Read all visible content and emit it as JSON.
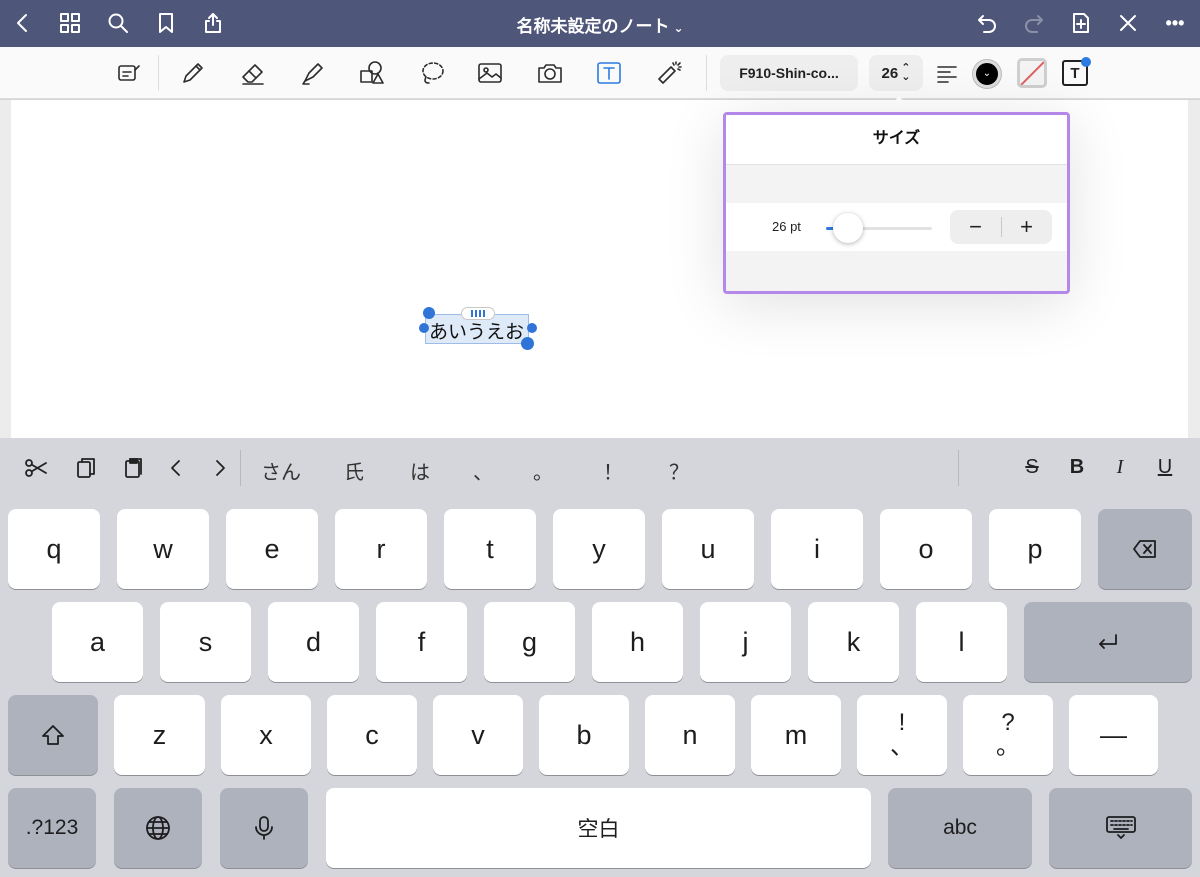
{
  "titlebar": {
    "title": "名称未設定のノート",
    "chevron": "⌄",
    "more": "•••"
  },
  "toolbar": {
    "font_name": "F910-Shin-co...",
    "font_size": "26",
    "size_arrows_up": "⌃",
    "size_arrows_down": "⌄",
    "text_box_label": "T",
    "color_selected": "#000000",
    "accent_color": "#2b7be0"
  },
  "canvas": {
    "text_content": "あいうえお"
  },
  "size_popover": {
    "title": "サイズ",
    "value_label": "26 pt",
    "slider_fraction": 0.08,
    "minus": "−",
    "plus": "+",
    "border_color": "#b488e8"
  },
  "shortcut_bar": {
    "suggestions": [
      "さん",
      "氏",
      "は",
      "、",
      "。",
      "！",
      "？"
    ],
    "format": {
      "strike": "S",
      "bold": "B",
      "italic": "I",
      "underline": "U"
    }
  },
  "keyboard": {
    "row1": [
      "q",
      "w",
      "e",
      "r",
      "t",
      "y",
      "u",
      "i",
      "o",
      "p"
    ],
    "row2": [
      "a",
      "s",
      "d",
      "f",
      "g",
      "h",
      "j",
      "k",
      "l"
    ],
    "row3": [
      "z",
      "x",
      "c",
      "v",
      "b",
      "n",
      "m"
    ],
    "key_excl_top": "!",
    "key_excl_bottom": "、",
    "key_q_top": "?",
    "key_q_bottom": "。",
    "key_dash": "—",
    "key_numbers": ".?123",
    "key_space": "空白",
    "key_abc": "abc"
  }
}
